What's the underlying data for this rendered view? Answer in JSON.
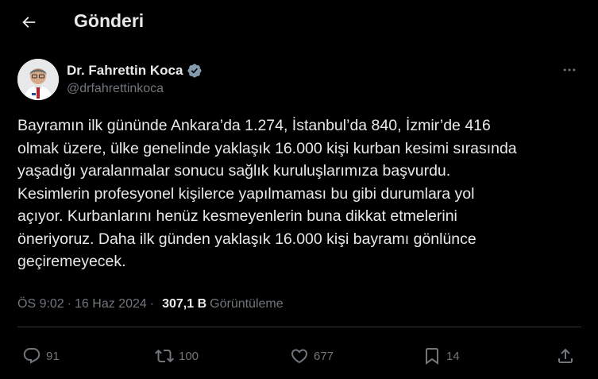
{
  "header": {
    "title": "Gönderi"
  },
  "author": {
    "name": "Dr. Fahrettin Koca",
    "handle": "@drfahrettinkoca"
  },
  "tweet": {
    "text": "Bayramın ilk gününde Ankara’da 1.274, İstanbul’da 840, İzmir’de 416\nolmak üzere, ülke genelinde yaklaşık 16.000 kişi kurban kesimi sırasında\nyaşadığı yaralanmalar sonucu sağlık kuruluşlarımıza başvurdu.\nKesimlerin profesyonel kişilerce yapılmaması bu gibi durumlara yol\naçıyor. Kurbanlarını henüz kesmeyenlerin buna dikkat etmelerini\nöneriyoruz. Daha ilk günden yaklaşık 16.000 kişi bayramı gönlünce\ngeçiremeyecek."
  },
  "meta": {
    "time": "ÖS 9:02",
    "separator": "·",
    "date": "16 Haz 2024",
    "views_count": "307,1 B",
    "views_label": "Görüntüleme"
  },
  "actions": {
    "replies": "91",
    "reposts": "100",
    "likes": "677",
    "bookmarks": "14"
  },
  "icons": [
    "back-arrow-icon",
    "verified-badge-icon",
    "more-options-icon",
    "reply-icon",
    "repost-icon",
    "like-icon",
    "bookmark-icon",
    "share-icon"
  ],
  "colors": {
    "background": "#000000",
    "text": "#e7e9ea",
    "muted": "#71767b",
    "verified": "#829aab",
    "divider": "#2f3336"
  }
}
